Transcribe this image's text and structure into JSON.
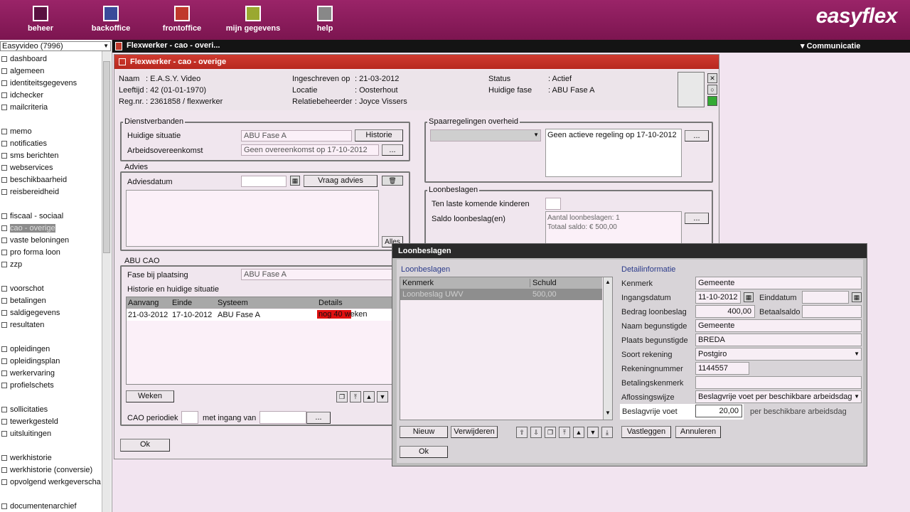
{
  "topnav": {
    "items": [
      {
        "label": "beheer",
        "icon": "beheer-icon"
      },
      {
        "label": "backoffice",
        "icon": "backoffice-icon"
      },
      {
        "label": "frontoffice",
        "icon": "frontoffice-icon"
      },
      {
        "label": "mijn gegevens",
        "icon": "mijn-gegevens-icon"
      },
      {
        "label": "help",
        "icon": "help-icon"
      }
    ],
    "logo": "easyflex"
  },
  "blackbar": {
    "window_tab": "Flexwerker - cao - overi...",
    "communicatie": "▾ Communicatie"
  },
  "sidebar": {
    "select_value": "Easyvideo (7996)",
    "items": [
      "dashboard",
      "algemeen",
      "identiteitsgegevens",
      "idchecker",
      "mailcriteria",
      "memo",
      "notificaties",
      "sms berichten",
      "webservices",
      "beschikbaarheid",
      "reisbereidheid",
      "fiscaal - sociaal",
      "cao - overige",
      "vaste beloningen",
      "pro forma loon",
      "zzp",
      "voorschot",
      "betalingen",
      "saldigegevens",
      "resultaten",
      "opleidingen",
      "opleidingsplan",
      "werkervaring",
      "profielschets",
      "sollicitaties",
      "tewerkgesteld",
      "uitsluitingen",
      "werkhistorie",
      "werkhistorie (conversie)",
      "opvolgend werkgeverscha",
      "documentenarchief"
    ],
    "selected": "cao - overige"
  },
  "main": {
    "title": "Flexwerker - cao - overige",
    "header": {
      "naam_label": "Naam",
      "naam": ": E.A.S.Y. Video",
      "leeftijd_label": "Leeftijd",
      "leeftijd": ": 42 (01-01-1970)",
      "regnr_label": "Reg.nr.",
      "regnr": ": 2361858 / flexwerker",
      "ingeschreven_label": "Ingeschreven op",
      "ingeschreven": ": 21-03-2012",
      "locatie_label": "Locatie",
      "locatie": ": Oosterhout",
      "relatie_label": "Relatiebeheerder",
      "relatie": ": Joyce Vissers",
      "status_label": "Status",
      "status": ": Actief",
      "fase_label": "Huidige fase",
      "fase": ": ABU Fase A"
    },
    "dienst": {
      "title": "Dienstverbanden",
      "situatie_label": "Huidige situatie",
      "situatie": "ABU Fase A",
      "historie_btn": "Historie",
      "arbeids_label": "Arbeidsovereenkomst",
      "arbeids": "Geen overeenkomst op 17-10-2012",
      "dots": "..."
    },
    "advies": {
      "title": "Advies",
      "datum_label": "Adviesdatum",
      "vraag_btn": "Vraag advies",
      "alles_btn": "Alles"
    },
    "abu": {
      "title": "ABU CAO",
      "fase_label": "Fase bij plaatsing",
      "fase": "ABU Fase A",
      "hist_label": "Historie en huidige situatie",
      "columns": [
        "Aanvang",
        "Einde",
        "Systeem",
        "Details"
      ],
      "row": [
        "21-03-2012",
        "17-10-2012",
        "ABU Fase A",
        "nog 40 weken"
      ],
      "weken_btn": "Weken",
      "periodiek_label": "CAO periodiek",
      "ingang_label": "met ingang van",
      "dots": "..."
    },
    "spaar": {
      "title": "Spaarregelingen overheid",
      "regeling": "Geen actieve regeling op 17-10-2012",
      "dots": "..."
    },
    "loon": {
      "title": "Loonbeslagen",
      "kinderen_label": "Ten laste komende kinderen",
      "saldo_label": "Saldo loonbeslag(en)",
      "saldo_line1": "Aantal loonbeslagen: 1",
      "saldo_line2": "Totaal saldo: € 500,00",
      "dots": "..."
    },
    "ok_btn": "Ok"
  },
  "dialog": {
    "title": "Loonbeslagen",
    "list_title": "Loonbeslagen",
    "columns": [
      "Kenmerk",
      "Schuld"
    ],
    "row": [
      "Loonbeslag UWV",
      "500,00"
    ],
    "detail_title": "Detailinformatie",
    "kenmerk_label": "Kenmerk",
    "kenmerk": "Gemeente",
    "ingang_label": "Ingangsdatum",
    "ingang": "11-10-2012",
    "einddatum_label": "Einddatum",
    "bedrag_label": "Bedrag loonbeslag",
    "bedrag": "400,00",
    "betaalsaldo_label": "Betaalsaldo",
    "naam_label": "Naam begunstigde",
    "naam": "Gemeente",
    "plaats_label": "Plaats begunstigde",
    "plaats": "BREDA",
    "soort_label": "Soort rekening",
    "soort": "Postgiro",
    "rekening_label": "Rekeningnummer",
    "rekening": "1144557",
    "betalings_label": "Betalingskenmerk",
    "aflossing_label": "Aflossingswijze",
    "aflossing": "Beslagvrije voet per beschikbare arbeidsdag",
    "voet_label": "Beslagvrije voet",
    "voet": "20,00",
    "voet_suffix": "per beschikbare arbeidsdag",
    "nieuw_btn": "Nieuw",
    "verwijderen_btn": "Verwijderen",
    "vastleggen_btn": "Vastleggen",
    "annuleren_btn": "Annuleren",
    "ok_btn": "Ok"
  }
}
